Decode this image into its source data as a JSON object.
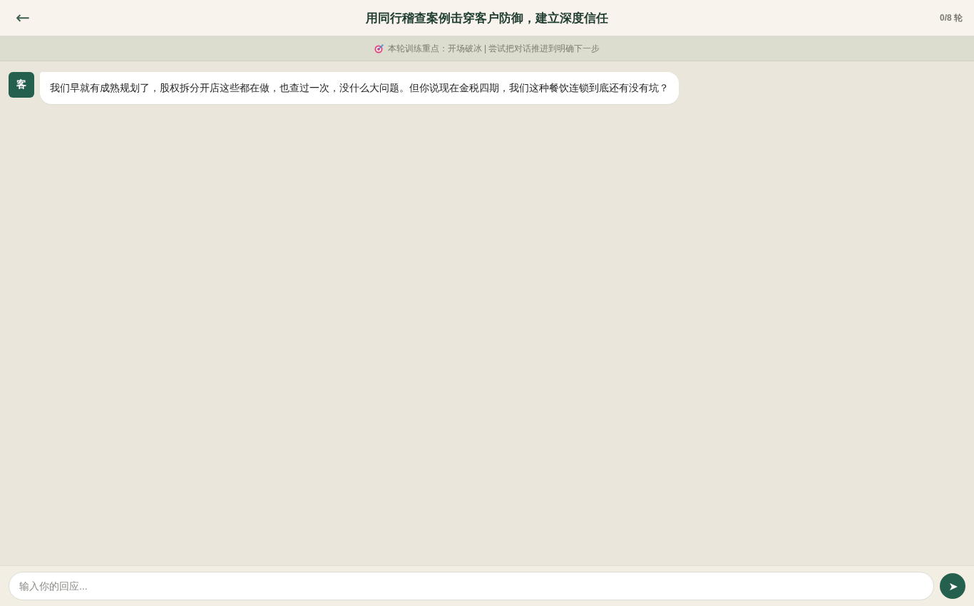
{
  "header": {
    "back": "←",
    "title": "用同行稽查案例击穿客户防御，建立深度信任",
    "progress": "0/8 轮"
  },
  "focus_bar": {
    "text": "本轮训练重点：开场破冰 | 尝试把对话推进到明确下一步"
  },
  "messages": [
    {
      "sender": "客",
      "text": "我们早就有成熟规划了，股权拆分开店这些都在做，也查过一次，没什么大问题。但你说现在金税四期，我们这种餐饮连锁到底还有没有坑？"
    }
  ],
  "composer": {
    "placeholder": "输入你的回应...",
    "send": "➤"
  }
}
